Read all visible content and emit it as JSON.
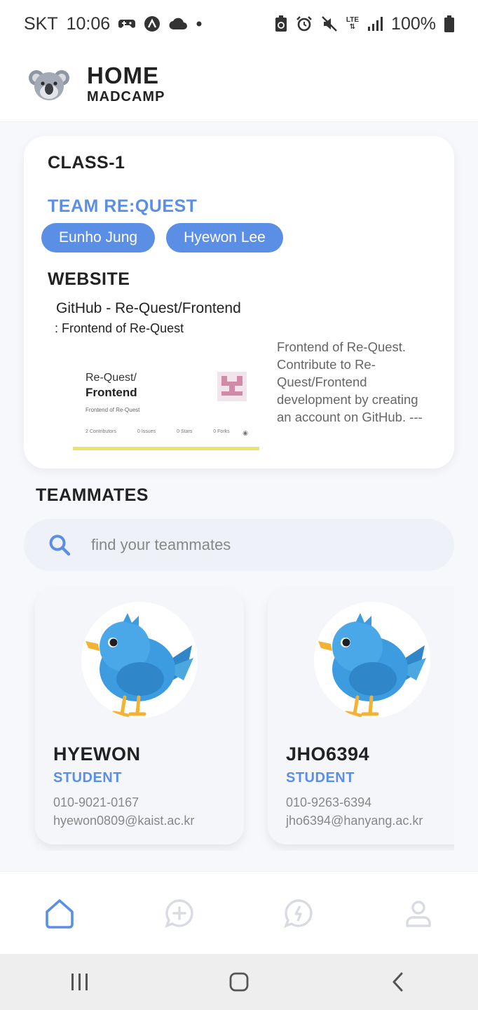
{
  "status_bar": {
    "carrier": "SKT",
    "time": "10:06",
    "network": "LTE",
    "battery": "100%",
    "icons_left": [
      "game-icon",
      "a-circle-icon",
      "cloud-icon",
      "dot-icon"
    ],
    "icons_right": [
      "battery-saver-icon",
      "alarm-icon",
      "mute-icon",
      "lte-icon",
      "signal-icon",
      "battery-icon"
    ]
  },
  "header": {
    "title": "HOME",
    "subtitle": "MADCAMP",
    "logo": "koala-icon"
  },
  "class_card": {
    "class_title": "CLASS-1",
    "team_name": "TEAM RE:QUEST",
    "members": [
      "Eunho Jung",
      "Hyewon Lee"
    ],
    "website_title": "WEBSITE",
    "link": {
      "title": "GitHub - Re-Quest/Frontend",
      "subtitle": ": Frontend of Re-Quest",
      "description": "Frontend of Re-Quest. Contribute to Re-Quest/Frontend development by creating an account on GitHub.  ---",
      "preview": {
        "repo_owner": "Re-Quest/",
        "repo_name": "Frontend",
        "repo_desc": "Frontend of Re-Quest",
        "stats": [
          {
            "value": "2",
            "label": "Contributors"
          },
          {
            "value": "0",
            "label": "Issues"
          },
          {
            "value": "0",
            "label": "Stars"
          },
          {
            "value": "0",
            "label": "Forks"
          }
        ]
      }
    }
  },
  "teammates": {
    "title": "TEAMMATES",
    "search_placeholder": "find your teammates",
    "search_value": "",
    "cards": [
      {
        "name": "HYEWON",
        "role": "STUDENT",
        "phone": "010-9021-0167",
        "email": "hyewon0809@kaist.ac.kr",
        "avatar": "bluebird-icon"
      },
      {
        "name": "JHO6394",
        "role": "STUDENT",
        "phone": "010-9263-6394",
        "email": "jho6394@hanyang.ac.kr",
        "avatar": "bluebird-icon"
      }
    ]
  },
  "bottom_nav": {
    "items": [
      "home-icon",
      "chat-add-icon",
      "chat-bolt-icon",
      "profile-icon"
    ],
    "active": "home-icon",
    "active_color": "#5b8fe6",
    "inactive_color": "#d8dbe2"
  },
  "system_nav": [
    "recents-icon",
    "home-button-icon",
    "back-icon"
  ]
}
